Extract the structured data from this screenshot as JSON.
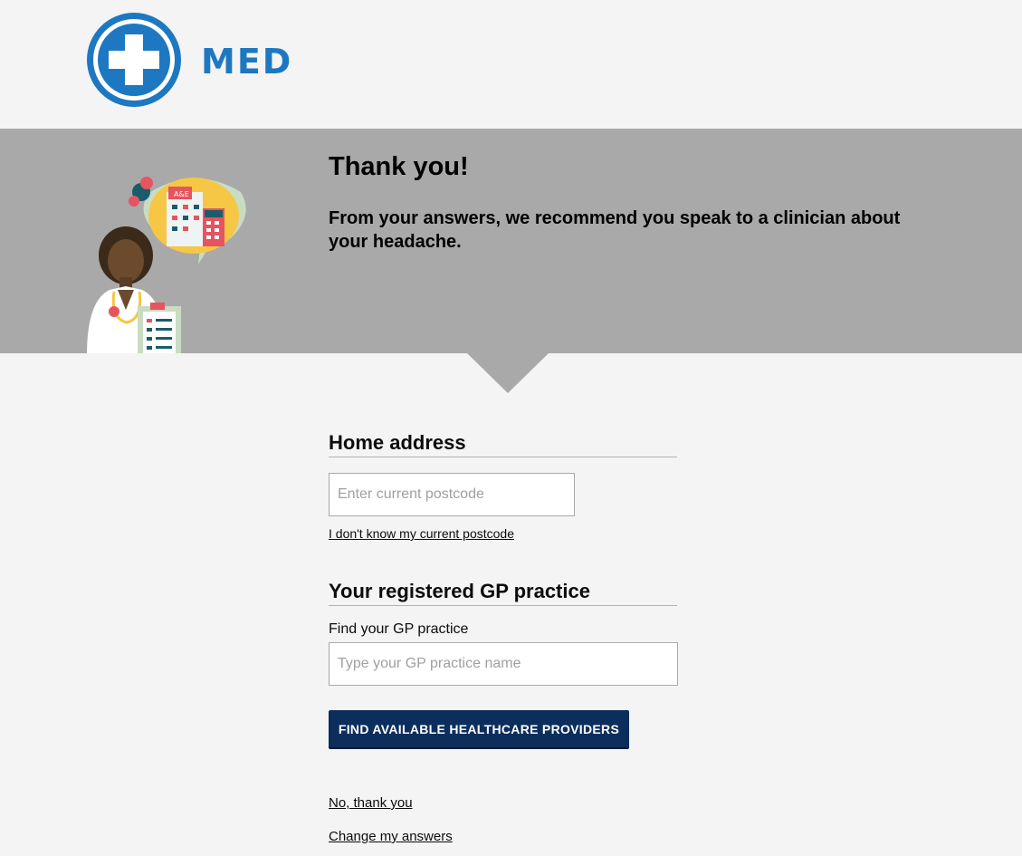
{
  "brand": {
    "name": "MED",
    "color": "#1d78c1",
    "icon": "medical-cross-icon"
  },
  "hero": {
    "title": "Thank you!",
    "message": "From your answers, we recommend you speak to a clinician about your headache.",
    "illustration": "doctor-with-hospital-thought-bubble",
    "sign_text": "A&E",
    "background": "#a9a9a9"
  },
  "home_address": {
    "heading": "Home address",
    "postcode_placeholder": "Enter current postcode",
    "unknown_postcode_link": "I don't know my current postcode"
  },
  "gp_practice": {
    "heading": "Your registered GP practice",
    "label": "Find your GP practice",
    "placeholder": "Type your GP practice name"
  },
  "actions": {
    "find_button": "FIND AVAILABLE HEALTHCARE PROVIDERS",
    "button_color": "#0b2e5c",
    "no_thanks_link": "No, thank you",
    "change_answers_link": "Change my answers"
  }
}
